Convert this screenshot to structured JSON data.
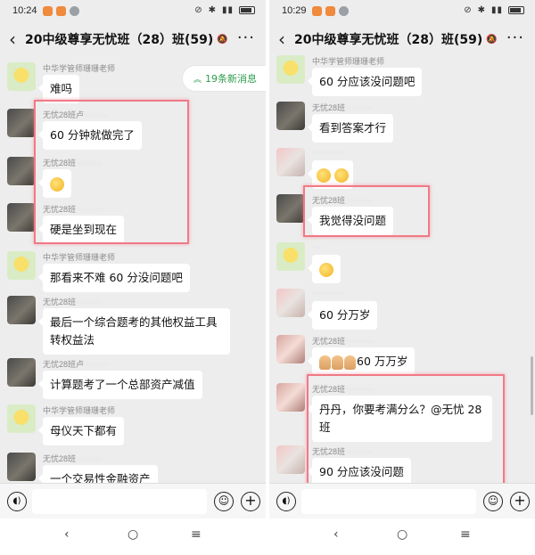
{
  "left": {
    "status": {
      "time": "10:24"
    },
    "header": {
      "title": "20中级尊享无忧班（28）班(59)"
    },
    "new_messages": "19条新消息",
    "messages": [
      {
        "sender": "中华学管师珊珊老师",
        "text": "难吗"
      },
      {
        "sender": "无忧28班卢",
        "text": "60 分钟就做完了"
      },
      {
        "sender": "无忧28班",
        "text": ""
      },
      {
        "sender": "无忧28班",
        "text": "硬是坐到现在"
      },
      {
        "sender": "中华学管师珊珊老师",
        "text": "那看来不难   60 分没问题吧"
      },
      {
        "sender": "无忧28班",
        "text": "最后一个综合题考的其他权益工具转权益法"
      },
      {
        "sender": "无忧28班卢",
        "text": "计算题考了一个总部资产减值"
      },
      {
        "sender": "中华学管师珊珊老师",
        "text": "母仪天下都有"
      },
      {
        "sender": "无忧28班",
        "text": "一个交易性金融资产"
      }
    ]
  },
  "right": {
    "status": {
      "time": "10:29"
    },
    "header": {
      "title": "20中级尊享无忧班（28）班(59)"
    },
    "messages": [
      {
        "sender": "中华学管师珊珊老师",
        "text": "60 分应该没问题吧"
      },
      {
        "sender": "无忧28班",
        "text": "看到答案才行"
      },
      {
        "sender": "",
        "text": ""
      },
      {
        "sender": "无忧28班",
        "text": "我觉得没问题"
      },
      {
        "sender": "",
        "text": ""
      },
      {
        "sender": "",
        "text": "60 分万岁"
      },
      {
        "sender": "无忧28班",
        "text": "60 万万岁"
      },
      {
        "sender": "无忧28班",
        "text": "丹丹，你要考满分么？@无忧 28 班"
      },
      {
        "sender": "无忧28班",
        "text": "90 分应该没问题"
      }
    ]
  },
  "icons": {
    "back": "chevron-left-icon",
    "more": "more-dots-icon",
    "voice": "voice-icon",
    "emoji": "emoji-icon",
    "plus": "plus-icon"
  },
  "colors": {
    "highlight": "#f07a86",
    "new_message_text": "#2e9c4e",
    "background": "#ededed"
  }
}
